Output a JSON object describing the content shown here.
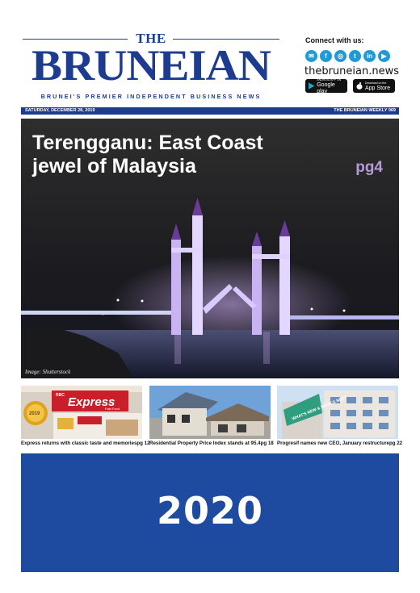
{
  "masthead": {
    "the": "THE",
    "title": "BRUNEIAN",
    "tagline": "BRUNEI'S PREMIER INDEPENDENT BUSINESS NEWS"
  },
  "connect": {
    "label": "Connect with us:",
    "social_icons": [
      "messenger-icon",
      "facebook-icon",
      "instagram-icon",
      "twitter-icon",
      "linkedin-icon",
      "youtube-icon"
    ],
    "social_glyphs": [
      "✉",
      "f",
      "◎",
      "t",
      "in",
      "▶"
    ],
    "url": "thebruneian.news",
    "google_play": {
      "small": "ANDROID APP ON",
      "large": "Google play"
    },
    "app_store": {
      "small": "Download on the",
      "large": "App Store"
    }
  },
  "date_bar": {
    "date": "SATURDAY, DECEMBER 28, 2019",
    "edition": "THE BRUNEIAN WEEKLY 069"
  },
  "hero": {
    "headline": "Terengganu: East Coast jewel of Malaysia",
    "page_ref": "pg4",
    "credit": "Image: Shutterstock"
  },
  "stories": [
    {
      "title": "Express returns with classic taste and memories",
      "page": "pg 12"
    },
    {
      "title": "Residential Property Price Index stands at 95.4",
      "page": "pg 18"
    },
    {
      "title": "Progresif names new CEO, January restructure",
      "page": "pg 22"
    }
  ],
  "thumb_text": {
    "express_brand": "Express",
    "express_sub": "Fast Food",
    "express_prefix": "RBC",
    "express_badge": "2019",
    "progresif_sign": "WHAT'S NEW & WHAT'S NEXT"
  },
  "ad": {
    "year": "2020"
  },
  "colors": {
    "brand_blue": "#1d3c8f",
    "ad_blue": "#1e4aa0",
    "pg_purple": "#b79ad8"
  }
}
